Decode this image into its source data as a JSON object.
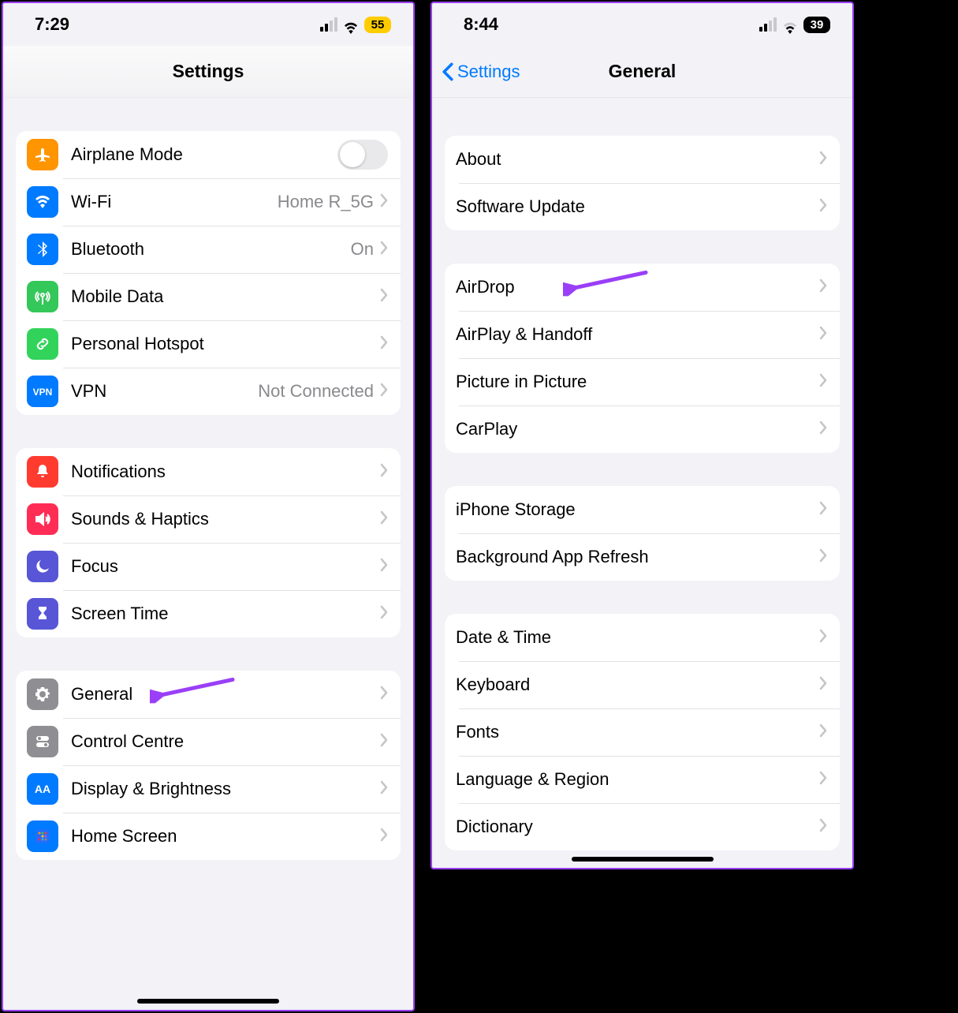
{
  "left": {
    "status": {
      "time": "7:29",
      "battery": "55"
    },
    "title": "Settings",
    "groups": [
      [
        {
          "icon": "airplane",
          "color": "c-orange",
          "label": "Airplane Mode",
          "toggle": true
        },
        {
          "icon": "wifi",
          "color": "c-blue",
          "label": "Wi-Fi",
          "value": "Home R_5G",
          "chev": true
        },
        {
          "icon": "bluetooth",
          "color": "c-blue",
          "label": "Bluetooth",
          "value": "On",
          "chev": true
        },
        {
          "icon": "antenna",
          "color": "c-green",
          "label": "Mobile Data",
          "chev": true
        },
        {
          "icon": "link",
          "color": "c-teal",
          "label": "Personal Hotspot",
          "chev": true
        },
        {
          "icon": "vpn",
          "color": "c-vpn",
          "label": "VPN",
          "value": "Not Connected",
          "chev": true
        }
      ],
      [
        {
          "icon": "bell",
          "color": "c-red",
          "label": "Notifications",
          "chev": true
        },
        {
          "icon": "speaker",
          "color": "c-pink",
          "label": "Sounds & Haptics",
          "chev": true
        },
        {
          "icon": "moon",
          "color": "c-indigo",
          "label": "Focus",
          "chev": true
        },
        {
          "icon": "hourglass",
          "color": "c-indigo",
          "label": "Screen Time",
          "chev": true
        }
      ],
      [
        {
          "icon": "gear",
          "color": "c-gray",
          "label": "General",
          "chev": true,
          "annotated": true
        },
        {
          "icon": "switches",
          "color": "c-gray",
          "label": "Control Centre",
          "chev": true
        },
        {
          "icon": "aa",
          "color": "c-blue",
          "label": "Display & Brightness",
          "chev": true
        },
        {
          "icon": "grid",
          "color": "c-blue",
          "label": "Home Screen",
          "chev": true
        }
      ]
    ]
  },
  "right": {
    "status": {
      "time": "8:44",
      "battery": "39"
    },
    "back": "Settings",
    "title": "General",
    "groups": [
      [
        {
          "label": "About",
          "chev": true
        },
        {
          "label": "Software Update",
          "chev": true
        }
      ],
      [
        {
          "label": "AirDrop",
          "chev": true,
          "annotated": true
        },
        {
          "label": "AirPlay & Handoff",
          "chev": true
        },
        {
          "label": "Picture in Picture",
          "chev": true
        },
        {
          "label": "CarPlay",
          "chev": true
        }
      ],
      [
        {
          "label": "iPhone Storage",
          "chev": true
        },
        {
          "label": "Background App Refresh",
          "chev": true
        }
      ],
      [
        {
          "label": "Date & Time",
          "chev": true
        },
        {
          "label": "Keyboard",
          "chev": true
        },
        {
          "label": "Fonts",
          "chev": true
        },
        {
          "label": "Language & Region",
          "chev": true
        },
        {
          "label": "Dictionary",
          "chev": true
        }
      ]
    ]
  }
}
